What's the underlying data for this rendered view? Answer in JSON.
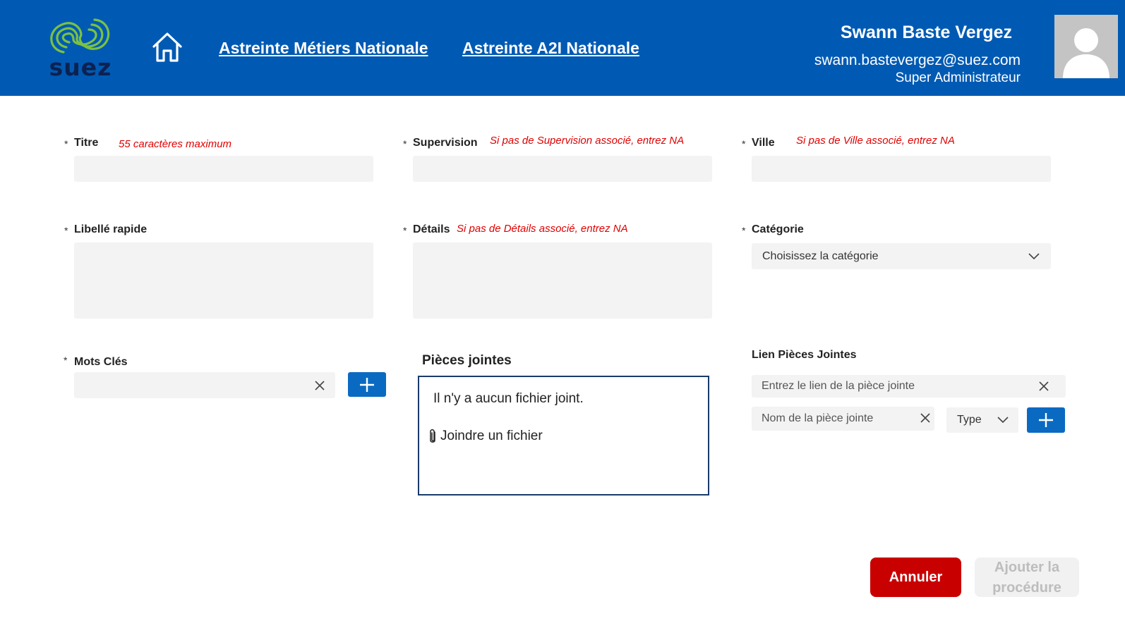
{
  "header": {
    "logo_text": "suez",
    "nav": {
      "link1": "Astreinte Métiers Nationale",
      "link2": "Astreinte A2I Nationale"
    },
    "user": {
      "name": "Swann Baste Vergez",
      "email": "swann.bastevergez@suez.com",
      "role": "Super Administrateur"
    },
    "icons": {
      "home": "home-icon",
      "avatar": "user-avatar-icon"
    }
  },
  "form": {
    "required_mark": "*",
    "titre": {
      "label": "Titre",
      "hint": "55 caractères maximum",
      "value": ""
    },
    "supervision": {
      "label": "Supervision",
      "hint": "Si pas de Supervision associé, entrez NA",
      "value": ""
    },
    "ville": {
      "label": "Ville",
      "hint": "Si pas de Ville associé, entrez NA",
      "value": ""
    },
    "libelle": {
      "label": "Libellé rapide",
      "value": ""
    },
    "details": {
      "label": "Détails",
      "hint": "Si pas de Détails associé, entrez NA",
      "value": ""
    },
    "categorie": {
      "label": "Catégorie",
      "selected": "Choisissez la catégorie"
    },
    "mots_cles": {
      "label": "Mots Clés",
      "value": ""
    },
    "pieces_jointes": {
      "title": "Pièces jointes",
      "empty": "Il n'y a aucun fichier joint.",
      "attach": "Joindre un fichier"
    },
    "lien": {
      "label": "Lien Pièces Jointes",
      "url_placeholder": "Entrez le lien de la pièce jointe",
      "name_placeholder": "Nom de la pièce jointe",
      "type_selected": "Type"
    }
  },
  "actions": {
    "cancel": "Annuler",
    "add_line1": "Ajouter la",
    "add_line2": "procédure"
  },
  "colors": {
    "header_bg": "#005ab3",
    "accent_blue": "#0a6ac2",
    "cancel_red": "#c90000",
    "hint_red": "#e00000",
    "logo_green": "#7ac143"
  }
}
